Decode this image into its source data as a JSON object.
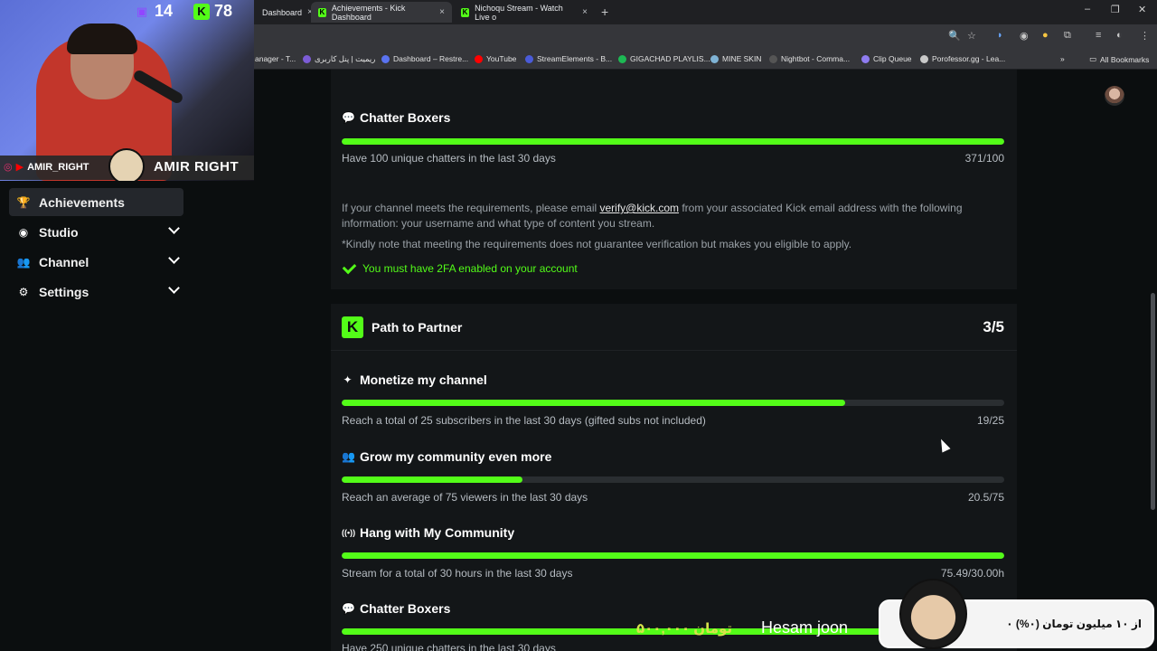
{
  "browser": {
    "tabs": [
      {
        "label": "Dashboard",
        "active": false
      },
      {
        "label": "Achievements - Kick Dashboard",
        "active": true
      },
      {
        "label": "Nichoqu Stream - Watch Live o",
        "active": false
      }
    ],
    "tab_close_glyph": "×",
    "new_tab_glyph": "+",
    "window_controls": [
      "–",
      "❐",
      "✕"
    ],
    "bookmarks": [
      {
        "label": "anager - T...",
        "color": "#6b6b6b"
      },
      {
        "label": "ریمیت | پنل کاربری",
        "color": "#7c5cd6"
      },
      {
        "label": "Dashboard – Restre...",
        "color": "#5a73f0"
      },
      {
        "label": "YouTube",
        "color": "#ff0000"
      },
      {
        "label": "StreamElements - B...",
        "color": "#4a5bd8"
      },
      {
        "label": "GIGACHAD PLAYLIS...",
        "color": "#1db954"
      },
      {
        "label": "MINE SKIN",
        "color": "#7fb3d5"
      },
      {
        "label": "Nightbot - Comma...",
        "color": "#222222"
      },
      {
        "label": "Clip Queue",
        "color": "#8f7cf0"
      },
      {
        "label": "Porofessor.gg - Lea...",
        "color": "#c9c9c9"
      }
    ],
    "bookmarks_more": "»",
    "all_bookmarks": "All Bookmarks"
  },
  "sidebar": {
    "items": [
      {
        "label": "Achievements",
        "icon": "trophy-icon",
        "glyph": "🏆",
        "active": true,
        "expandable": false
      },
      {
        "label": "Studio",
        "icon": "studio-icon",
        "glyph": "◉",
        "active": false,
        "expandable": true
      },
      {
        "label": "Channel",
        "icon": "users-icon",
        "glyph": "👥",
        "active": false,
        "expandable": true
      },
      {
        "label": "Settings",
        "icon": "gear-icon",
        "glyph": "⚙",
        "active": false,
        "expandable": true
      }
    ]
  },
  "verification": {
    "tasks": [
      {
        "title": "Chatter Boxers",
        "icon": "chat-icon",
        "glyph": "💬",
        "progress": 1.0,
        "desc": "Have 100 unique chatters in the last 30 days",
        "count": "371/100"
      }
    ],
    "info_prefix": "If your channel meets the requirements, please email ",
    "info_email": "verify@kick.com",
    "info_suffix": " from your associated Kick email address with the following information: your username and what type of content you stream.",
    "note": "*Kindly note that meeting the requirements does not guarantee verification but makes you eligible to apply.",
    "twofa": "You must have 2FA enabled on your account"
  },
  "partner": {
    "title": "Path to Partner",
    "logo_letter": "K",
    "score": "3/5",
    "tasks": [
      {
        "title": "Monetize my channel",
        "icon": "sparkle-icon",
        "glyph": "✦",
        "progress": 0.76,
        "desc": "Reach a total of 25 subscribers in the last 30 days (gifted subs not included)",
        "count": "19/25"
      },
      {
        "title": "Grow my community even more",
        "icon": "users-icon",
        "glyph": "👥",
        "progress": 0.273,
        "desc": "Reach an average of 75 viewers in the last 30 days",
        "count": "20.5/75"
      },
      {
        "title": "Hang with My Community",
        "icon": "broadcast-icon",
        "glyph": "((•))",
        "progress": 1.0,
        "desc": "Stream for a total of 30 hours in the last 30 days",
        "count": "75.49/30.00h"
      },
      {
        "title": "Chatter Boxers",
        "icon": "chat-icon",
        "glyph": "💬",
        "progress": 1.0,
        "desc": "Have 250 unique chatters in the last 30 days",
        "count": ""
      }
    ]
  },
  "overlay": {
    "twitch_count": "14",
    "kick_count": "78",
    "kick_letter": "K",
    "handle_left": "AMIR_RIGHT",
    "handle_right": "AMIR RIGHT",
    "donor_name": "Hesam joon",
    "donor_amount": "۵۰۰,۰۰۰ تومان",
    "donation_goal": "۰ از ۱۰ میلیون تومان (۰%)"
  },
  "colors": {
    "accent": "#53fc18",
    "track": "#2a2e31",
    "card": "#131618",
    "page": "#0b0e0f"
  }
}
